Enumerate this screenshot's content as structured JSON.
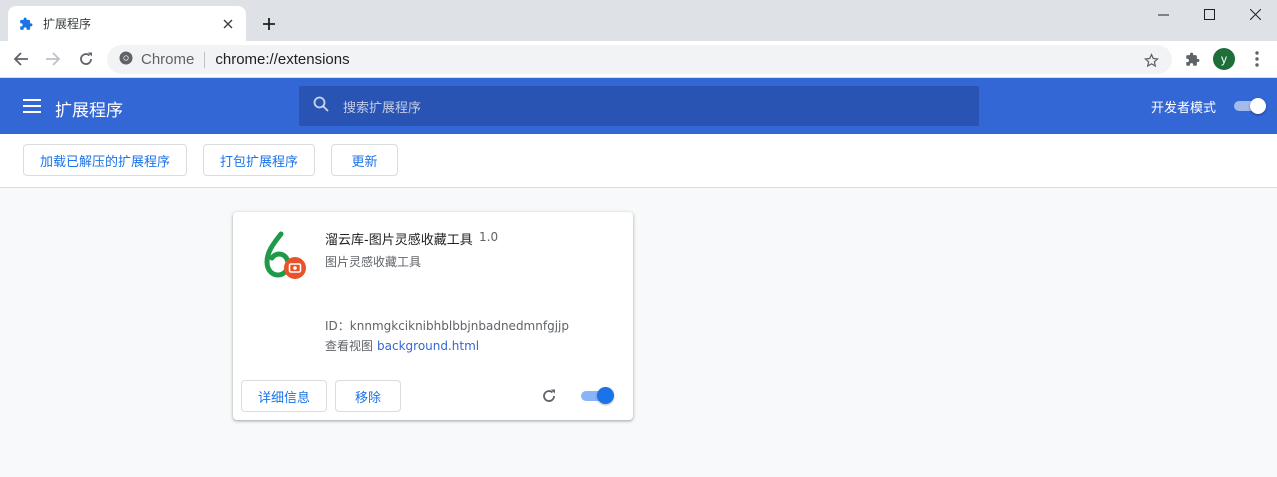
{
  "browser": {
    "tab": {
      "title": "扩展程序",
      "favicon": "puzzle-icon"
    },
    "omnibox": {
      "site_label": "Chrome",
      "url": "chrome://extensions"
    },
    "profile": {
      "initial": "y",
      "color": "#1e6e3a"
    }
  },
  "header": {
    "title": "扩展程序",
    "search_placeholder": "搜索扩展程序",
    "dev_mode_label": "开发者模式",
    "dev_mode_on": true,
    "color": "#3367d6"
  },
  "actions": {
    "load_unpacked": "加载已解压的扩展程序",
    "pack": "打包扩展程序",
    "update": "更新"
  },
  "extension": {
    "name": "溜云库-图片灵感收藏工具",
    "version": "1.0",
    "description": "图片灵感收藏工具",
    "id_line": "ID：knnmgkciknibhblbbjnbadnedmnfgjjp",
    "views_label": "查看视图",
    "views_link": "background.html",
    "details_button": "详细信息",
    "remove_button": "移除",
    "enabled": true,
    "icon": "liuyunku-logo"
  }
}
